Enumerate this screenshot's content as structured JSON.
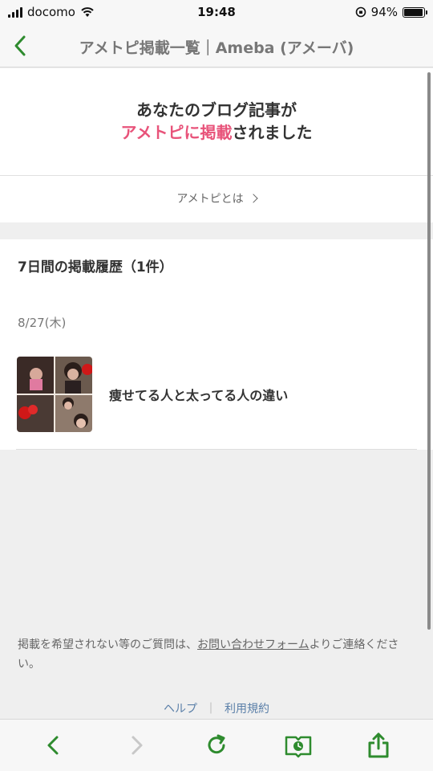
{
  "status_bar": {
    "carrier": "docomo",
    "time": "19:48",
    "battery_percent": "94%",
    "battery_level": 0.94
  },
  "nav": {
    "title": "アメトピ掲載一覧｜Ameba (アメーバ)"
  },
  "hero": {
    "line1": "あなたのブログ記事が",
    "line2_highlight": "アメトピに掲載",
    "line2_rest": "されました"
  },
  "about_link": "アメトピとは",
  "history": {
    "title": "7日間の掲載履歴（1件）",
    "date": "8/27(木)",
    "articles": [
      {
        "title": "痩せてる人と太ってる人の違い"
      }
    ]
  },
  "footer": {
    "note_before": "掲載を希望されない等のご質問は、",
    "note_link": "お問い合わせフォーム",
    "note_after": "よりご連絡ください。",
    "help": "ヘルプ",
    "separator": "｜",
    "terms": "利用規約"
  },
  "colors": {
    "accent_green": "#2e8b2e",
    "highlight_pink": "#e8537a",
    "link_blue": "#5a7fa8"
  },
  "icons": {
    "back": "chevron-left-icon",
    "forward": "chevron-right-icon",
    "reload": "reload-icon",
    "history": "book-clock-icon",
    "share": "share-icon"
  }
}
